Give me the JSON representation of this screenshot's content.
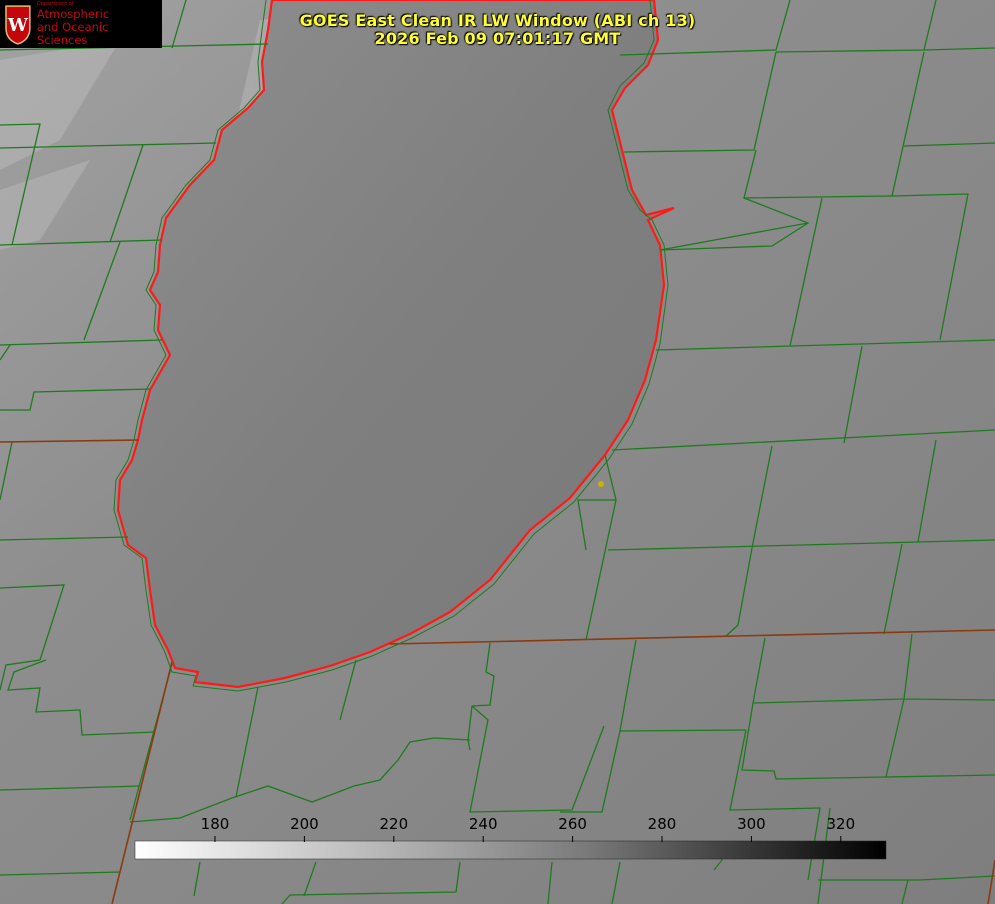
{
  "title": {
    "line1": "GOES East Clean IR LW Window (ABI ch 13)",
    "line2": "2026 Feb 09 07:01:17 GMT"
  },
  "logo": {
    "dept": "Department of",
    "line1": "Atmospheric",
    "line2": "and Oceanic Sciences",
    "seal_letter": "W"
  },
  "colorbar": {
    "ticks": [
      "180",
      "200",
      "220",
      "240",
      "260",
      "280",
      "300",
      "320"
    ],
    "gradient_from": "#ffffff",
    "gradient_to": "#000000"
  },
  "colors": {
    "title": "#ffff33",
    "coastline": "#ff1a1a",
    "county_lines": "#1f7a1f",
    "state_lines": "#8a3a10",
    "marker": "#c8b400",
    "lake_fill": "#7d7d7d",
    "land_fill": "#888888"
  }
}
